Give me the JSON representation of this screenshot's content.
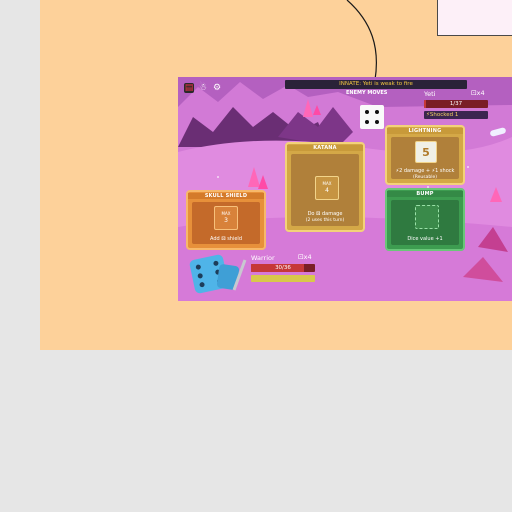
{
  "colors": {
    "canvas_bg": "#e6e6e6",
    "peach_panel": "#fdd19a",
    "note_bg": "#fdf0f8",
    "card_orange": "#e7903a",
    "card_yellow": "#d4a847",
    "card_green": "#3d9c50",
    "hp_red": "#c63838",
    "hp_yellow": "#d8c84a"
  },
  "game": {
    "innate_banner": "INNATE: Yeti is weak to fire",
    "enemy_moves_label": "ENEMY MOVES",
    "top_icons": [
      "menu-icon",
      "character-icon",
      "settings-icon"
    ],
    "enemy": {
      "name": "Yeti",
      "dice_count": "x4",
      "hp_text": "1/37",
      "hp_fraction": 0.03,
      "status": "Shocked 1"
    },
    "enemy_die_face": 4,
    "cards": [
      {
        "id": "skull-shield",
        "title": "SKULL SHIELD",
        "slot_top": "MAX",
        "slot_value": "3",
        "desc_lines": [
          "Add ⚄ shield"
        ],
        "color": "#e7903a"
      },
      {
        "id": "katana",
        "title": "KATANA",
        "slot_top": "MAX",
        "slot_value": "4",
        "desc_lines": [
          "Do ⚄ damage",
          "(2 uses this turn)"
        ],
        "color": "#d4a847"
      },
      {
        "id": "lightning",
        "title": "LIGHTNING",
        "slot_top": "",
        "slot_value": "5",
        "desc_lines": [
          "⚡2 damage + ⚡1 shock",
          "(Reusable)"
        ],
        "color": "#d4a847"
      },
      {
        "id": "bump",
        "title": "BUMP",
        "slot_top": "",
        "slot_value": "",
        "desc_lines": [
          "Dice value +1"
        ],
        "color": "#3d9c50"
      }
    ],
    "player": {
      "name": "Warrior",
      "dice_count": "x4",
      "hp_text": "30/36",
      "hp_fraction": 0.83
    }
  }
}
